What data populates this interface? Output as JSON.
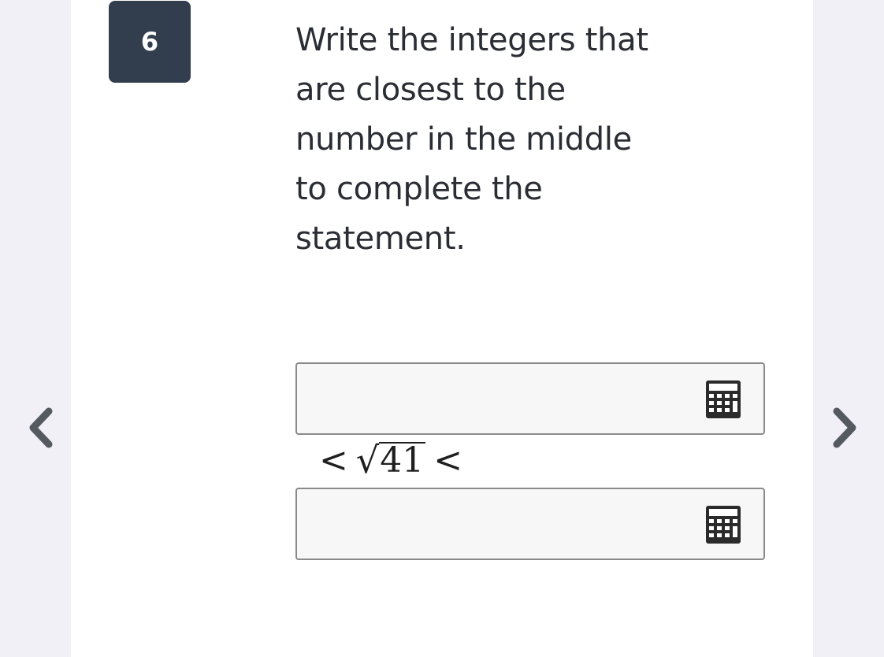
{
  "question": {
    "number": "6",
    "prompt_lines": [
      "Write the integers that",
      "are closest to the",
      "number in the middle",
      "to complete the",
      "statement."
    ]
  },
  "inequality": {
    "left_symbol": "<",
    "radical_symbol": "√",
    "radicand": "41",
    "right_symbol": "<"
  },
  "answers": {
    "lower_value": "",
    "upper_value": ""
  },
  "icons": {
    "calculator": "calculator-icon",
    "prev": "chevron-left-icon",
    "next": "chevron-right-icon"
  },
  "colors": {
    "badge_background": "#323e4d",
    "page_background": "#f0f0f6",
    "card_background": "#ffffff",
    "text": "#2a2d33",
    "input_border": "#8a8a8a",
    "input_background": "#f7f7f7",
    "arrow": "#555a60"
  }
}
